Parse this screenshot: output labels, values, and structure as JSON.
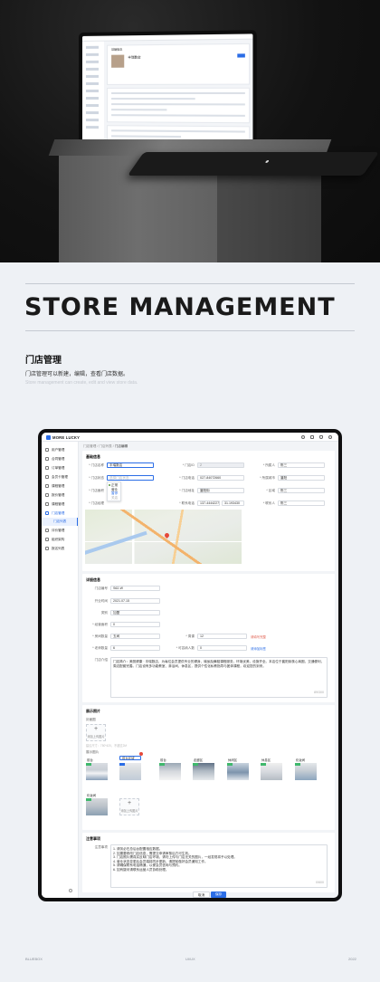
{
  "hero": {
    "mini_screen": {
      "section_label": "基础信息",
      "store_name": "丰瑞数店"
    }
  },
  "page": {
    "title": "STORE MANAGEMENT",
    "subtitle": "门店管理",
    "description": "门店管理可以新建，编辑，查看门店数据。",
    "description_en": "Store management can create, edit and view store data."
  },
  "app": {
    "logo": "MORE LUCKY",
    "topbar_icons": [
      "search-icon",
      "grid-icon",
      "bell-icon",
      "user-icon"
    ],
    "sidebar": [
      {
        "label": "用户管理"
      },
      {
        "label": "合同管理"
      },
      {
        "label": "订单管理"
      },
      {
        "label": "会员卡管理"
      },
      {
        "label": "课程管理"
      },
      {
        "label": "报价管理"
      },
      {
        "label": "课程管理"
      },
      {
        "label": "门店管理",
        "active": true
      },
      {
        "label": "评价管理"
      },
      {
        "label": "组织架构"
      },
      {
        "label": "报名列表"
      }
    ],
    "sidebar_sub": "门店列表",
    "breadcrumb": {
      "path": "门店管理 / 门店列表 / ",
      "current": "门店编辑"
    },
    "basic": {
      "heading": "基础信息",
      "fields": {
        "store_name": {
          "label": "* 门店名称",
          "value": "丰瑞数店"
        },
        "store_id": {
          "label": "* 门店ID",
          "value": "2"
        },
        "owner": {
          "label": "* 所属人",
          "value": "陈三"
        },
        "store_status": {
          "label": "* 门店状态",
          "value": "选择门店状态"
        },
        "store_phone": {
          "label": "* 门店电话",
          "value": "027-84072660"
        },
        "city": {
          "label": "* 所属城市",
          "value": "襄阳"
        },
        "store_area": {
          "label": "* 门店面积",
          "value": ""
        },
        "store_address": {
          "label": "* 门店地址",
          "value": "襄阳街"
        },
        "district": {
          "label": "* 区域",
          "value": "陈三"
        },
        "store_manager": {
          "label": "* 门店经理",
          "value": ""
        },
        "manager_phone": {
          "label": "* 联系电话",
          "value": "137-44442277"
        },
        "zip": {
          "label": "",
          "value": "31.193430"
        },
        "contact": {
          "label": "* 联系人",
          "value": "陈三"
        }
      },
      "status_options": [
        {
          "label": "正常",
          "selected": false
        },
        {
          "label": "营业",
          "selected": false
        },
        {
          "label": "暂停",
          "selected": true
        },
        {
          "label": "关店",
          "selected": false
        }
      ]
    },
    "detail": {
      "heading": "详细信息",
      "fields": {
        "store_code": {
          "label": "门店编号",
          "value": "S62-W"
        },
        "open_date": {
          "label": "开业时间",
          "value": "2021.07.15"
        },
        "type": {
          "label": "类别",
          "value": "加盟"
        },
        "area": {
          "label": "* 经营面积",
          "value": "0"
        },
        "rooms": {
          "label": "* 房间数量",
          "value": "五间"
        },
        "discount": {
          "label": "* 周课",
          "value": "12"
        },
        "discount_hint": "请填写完整",
        "teachers": {
          "label": "* 老师数量",
          "value": "6"
        },
        "capacity": {
          "label": "* 可容纳人数",
          "value": "0"
        },
        "capacity_hint": "请添加标签",
        "intro_label": "门店介绍",
        "intro": "门店简介：美丽健康 · 丰瑞数店，为每位会员提供专业的健身、瑜伽及舞蹈课程服务，环境优美，设施齐全。本店位于襄阳街核心商圈，交通便利，周边配套完善。门店设有多功能教室、淋浴间、休息区，提供个性化私教指导与团体课程，欢迎您的到来。",
        "intro_count": "89/300"
      }
    },
    "photos": {
      "heading": "展示照片",
      "cover_label": "封面图",
      "upload_text": "添加上传图片",
      "cover_hint": "建议尺寸：750*420，不超过2M",
      "gallery_label": "展示图片",
      "gallery_hint": "请输入图片标题",
      "items": [
        {
          "title": "前台"
        },
        {
          "title": "前台区域"
        },
        {
          "title": "前台"
        },
        {
          "title": "走廊区"
        },
        {
          "title": "休闲区"
        },
        {
          "title": "休息区"
        },
        {
          "title": "化妆间"
        },
        {
          "title": "化妆间"
        }
      ]
    },
    "notes": {
      "heading": "注意事项",
      "label": "注意事项",
      "lines": [
        "1. 请务必在总后台配置相应数据。",
        "2. 如果要修改门店信息，需提交申请审核后方可生效。",
        "3. 门店照片需真实反映门店环境，请勿上传与门店无关的图片，一经发现将予以处理。",
        "4. 营业状态变更后会员端将同步更新，请提前做好会员通知工作。",
        "5. 请确保联系电话畅通，以便会员咨询与预约。",
        "6. 如有疑问请联系运营人员协助处理。"
      ],
      "count": "0/600"
    },
    "footer": {
      "cancel": "取消",
      "save": "保存"
    }
  },
  "footer_meta": {
    "left": "BLUEBOX",
    "center": "UI/UX",
    "right": "2022"
  }
}
